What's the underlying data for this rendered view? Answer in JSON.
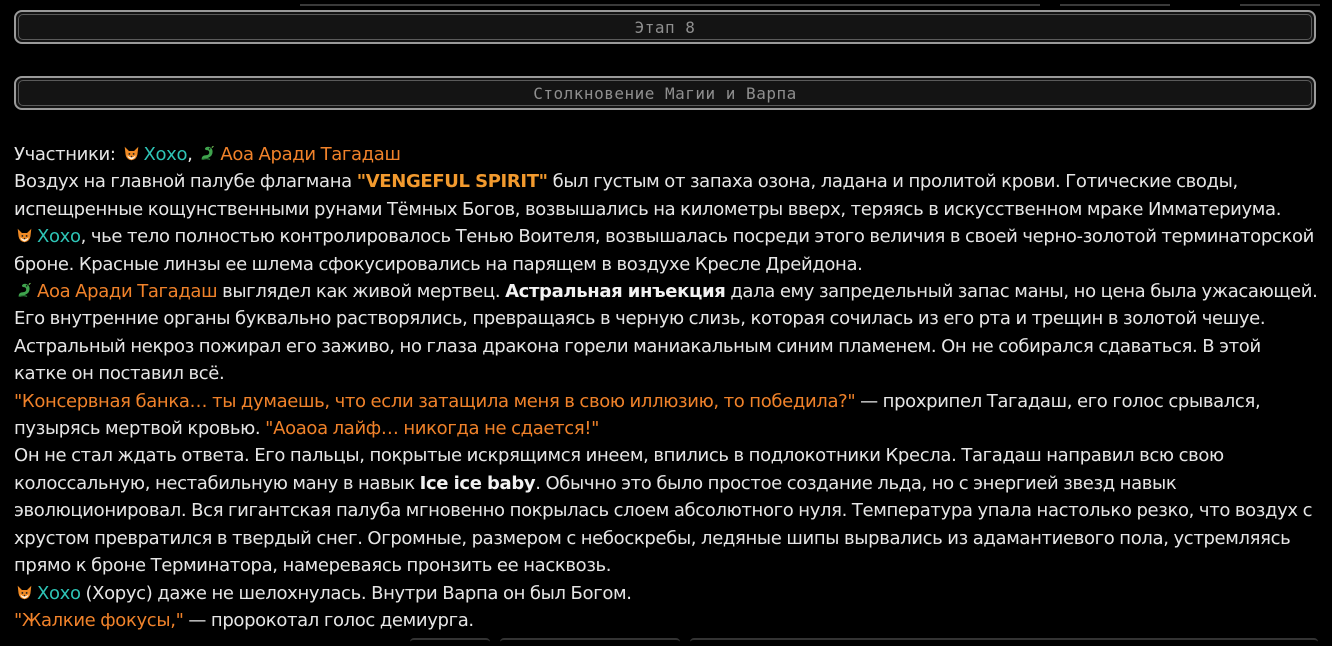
{
  "header": {
    "stage_label": "Этап 8",
    "chapter_title": "Столкновение Магии и Варпа"
  },
  "characters": {
    "hoho": {
      "name": "Хохо",
      "icon": "fox-icon",
      "color": "#2ec4b6"
    },
    "tagadash": {
      "name": "Аоа Аради Тагадаш",
      "icon": "dragon-icon",
      "color": "#f0822a"
    }
  },
  "participants": {
    "label": "Участники:",
    "separator": ","
  },
  "paragraphs": {
    "p1": {
      "before": "Воздух на главной палубе флагмана ",
      "ship": "\"VENGEFUL SPIRIT\"",
      "after": " был густым от запаха озона, ладана и пролитой крови. Готические своды, испещренные кощунственными рунами Тёмных Богов, возвышались на километры вверх, теряясь в искусственном мраке Имматериума."
    },
    "p2": {
      "text": ", чье тело полностью контролировалось Тенью Воителя, возвышалась посреди этого величия в своей черно-золотой терминаторской броне. Красные линзы ее шлема сфокусировались на парящем в воздухе Кресле Дрейдона."
    },
    "p3": {
      "before": " выглядел как живой мертвец. ",
      "skill": "Астральная инъекция",
      "after": " дала ему запредельный запас маны, но цена была ужасающей. Его внутренние органы буквально растворялись, превращаясь в черную слизь, которая сочилась из его рта и трещин в золотой чешуе. Астральный некроз пожирал его заживо, но глаза дракона горели маниакальным синим пламенем. Он не собирался сдаваться. В этой катке он поставил всё."
    },
    "p4": {
      "quote1": "\"Консервная банка… ты думаешь, что если затащила меня в свою иллюзию, то победила?\"",
      "middle": " — прохрипел Тагадаш, его голос срывался, пузырясь мертвой кровью. ",
      "quote2": "\"Аоаоа лайф… никогда не сдается!\""
    },
    "p5": {
      "before": "Он не стал ждать ответа. Его пальцы, покрытые искрящимся инеем, впились в подлокотники Кресла. Тагадаш направил всю свою колоссальную, нестабильную ману в навык ",
      "skill": "Ice ice baby",
      "after": ". Обычно это было простое создание льда, но с энергией звезд навык эволюционировал. Вся гигантская палуба мгновенно покрылась слоем абсолютного нуля. Температура упала настолько резко, что воздух с хрустом превратился в твердый снег. Огромные, размером с небоскребы, ледяные шипы вырвались из адамантиевого пола, устремляясь прямо к броне Терминатора, намереваясь пронзить ее насквозь."
    },
    "p6": {
      "text": " (Хорус) даже не шелохнулась. Внутри Варпа он был Богом."
    },
    "p7": {
      "quote": "\"Жалкие фокусы,\"",
      "after": " — пророкотал голос демиурга."
    }
  }
}
